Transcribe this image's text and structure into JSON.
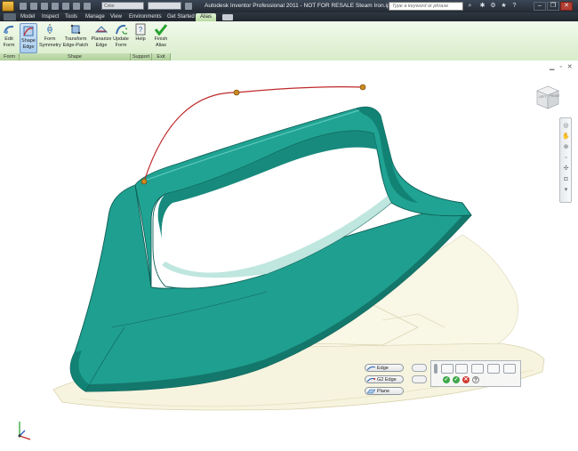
{
  "titlebar": {
    "title": "Autodesk Inventor Professional 2011 - NOT FOR RESALE    Steam Iron.ipt",
    "search_placeholder": "Type a keyword or phrase",
    "color_combo": "Color"
  },
  "tabs": [
    {
      "label": "Model"
    },
    {
      "label": "Inspect"
    },
    {
      "label": "Tools"
    },
    {
      "label": "Manage"
    },
    {
      "label": "View"
    },
    {
      "label": "Environments"
    },
    {
      "label": "Get Started"
    },
    {
      "label": "Alias",
      "active": true
    }
  ],
  "ribbon": {
    "buttons": [
      {
        "label": "Edit\nForm",
        "icon": "edit-form-icon"
      },
      {
        "label": "Shape\nEdge",
        "icon": "shape-edge-icon",
        "selected": true
      },
      {
        "label": "Form\nSymmetry",
        "icon": "form-symmetry-icon"
      },
      {
        "label": "Transform\nEdge-Patch",
        "icon": "transform-edge-patch-icon"
      },
      {
        "label": "Planarize\nEdge",
        "icon": "planarize-edge-icon"
      },
      {
        "label": "Update\nForm",
        "icon": "update-form-icon"
      },
      {
        "label": "Help",
        "icon": "help-icon"
      },
      {
        "label": "Finish\nAlias",
        "icon": "finish-check-icon"
      }
    ],
    "groups": [
      {
        "label": "Form"
      },
      {
        "label": "Shape"
      },
      {
        "label": "Support"
      },
      {
        "label": "Exit"
      }
    ]
  },
  "viewcube": {
    "top": "TOP",
    "left": "LEFT",
    "front": "FRONT"
  },
  "minitoolbar": {
    "commands": [
      {
        "label": "Edge"
      },
      {
        "label": "G2 Edge"
      },
      {
        "label": "Plane"
      }
    ]
  },
  "colors": {
    "teal": "#1f9f90",
    "teal_dark": "#0f6f64",
    "ghost": "#f4f2dc",
    "curve": "#c0292b",
    "ribbon": "#e3f1d9",
    "accent_green": "#27a22f"
  }
}
